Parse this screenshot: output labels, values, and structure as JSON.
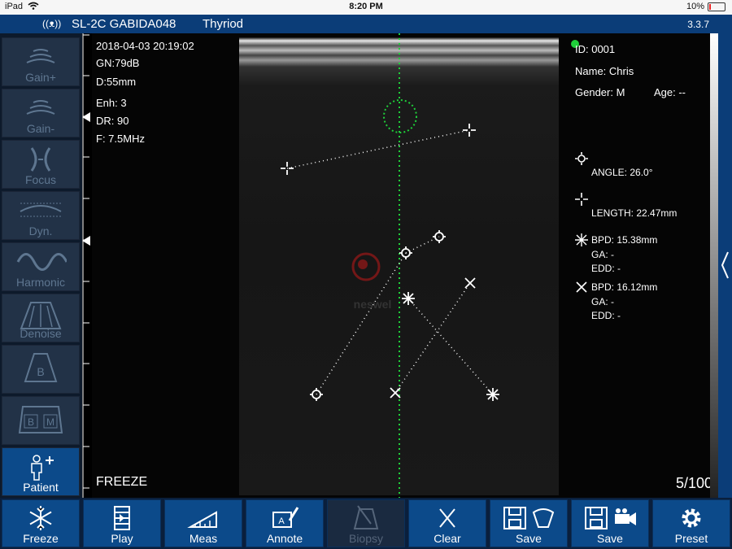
{
  "status_bar": {
    "device": "iPad",
    "time": "8:20 PM",
    "battery": "10%"
  },
  "top_bar": {
    "probe": "SL-2C GABIDA048",
    "preset": "Thyriod",
    "version": "3.3.7"
  },
  "sidebar": {
    "items": [
      {
        "label": "Gain+",
        "icon": "gain-plus-icon",
        "active": false
      },
      {
        "label": "Gain-",
        "icon": "gain-minus-icon",
        "active": false
      },
      {
        "label": "Focus",
        "icon": "focus-icon",
        "active": false
      },
      {
        "label": "Dyn.",
        "icon": "dynamic-range-icon",
        "active": false
      },
      {
        "label": "Harmonic",
        "icon": "harmonic-wave-icon",
        "active": false
      },
      {
        "label": "Denoise",
        "icon": "denoise-icon",
        "active": false
      },
      {
        "label": "",
        "icon": "b-mode-icon",
        "active": false
      },
      {
        "label": "",
        "icon": "bm-mode-icon",
        "active": false
      },
      {
        "label": "Patient",
        "icon": "patient-icon",
        "active": true
      }
    ]
  },
  "image_info": {
    "datetime": "2018-04-03 20:19:02",
    "gain": "GN:79dB",
    "depth": "D:55mm",
    "enhancement": "Enh: 3",
    "dynamic_range": "DR: 90",
    "frequency": "F: 7.5MHz",
    "mode": "FREEZE",
    "frame": "5/100",
    "watermark": "neswel"
  },
  "patient": {
    "id": "ID: 0001",
    "name": "Name: Chris",
    "gender": "Gender: M",
    "age": "Age: --"
  },
  "measurements": {
    "angle": "ANGLE: 26.0°",
    "length": "LENGTH: 22.47mm",
    "bpd1": {
      "bpd": "BPD: 15.38mm",
      "ga": "GA: -",
      "edd": "EDD: -"
    },
    "bpd2": {
      "bpd": "BPD: 16.12mm",
      "ga": "GA: -",
      "edd": "EDD: -"
    }
  },
  "bottom_bar": {
    "buttons": [
      {
        "label": "Freeze",
        "icon": "snowflake-icon",
        "enabled": true
      },
      {
        "label": "Play",
        "icon": "film-play-icon",
        "enabled": true
      },
      {
        "label": "Meas",
        "icon": "ruler-icon",
        "enabled": true
      },
      {
        "label": "Annote",
        "icon": "annotate-icon",
        "enabled": true
      },
      {
        "label": "Biopsy",
        "icon": "biopsy-icon",
        "enabled": false
      },
      {
        "label": "Clear",
        "icon": "clear-x-icon",
        "enabled": true
      },
      {
        "label": "Save",
        "icon": "save-image-icon",
        "enabled": true
      },
      {
        "label": "Save",
        "icon": "save-video-icon",
        "enabled": true
      },
      {
        "label": "Preset",
        "icon": "gear-icon",
        "enabled": true
      }
    ]
  },
  "colors": {
    "accent": "#0c4a8a",
    "header": "#0b3d78",
    "caliper_green": "#1fcf3a"
  }
}
